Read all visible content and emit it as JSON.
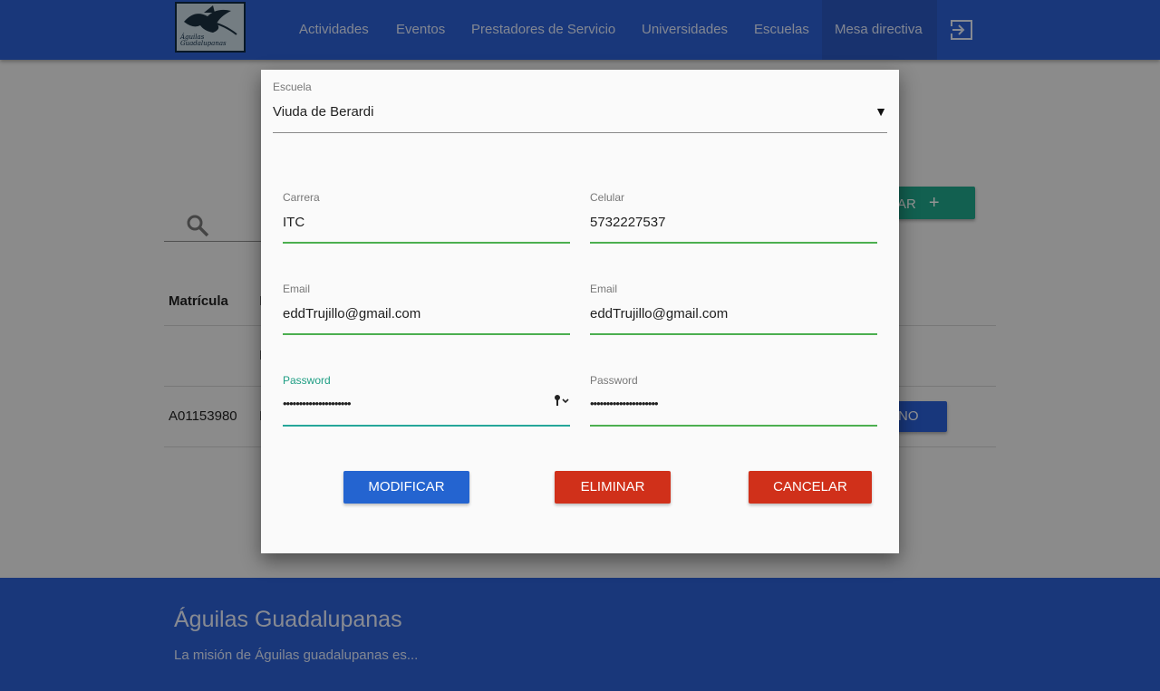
{
  "nav": {
    "logo_text": "Águilas Guadalupanas",
    "items": [
      {
        "label": "Actividades"
      },
      {
        "label": "Eventos"
      },
      {
        "label": "Prestadores de Servicio"
      },
      {
        "label": "Universidades"
      },
      {
        "label": "Escuelas"
      },
      {
        "label": "Mesa directiva"
      }
    ],
    "active_item": "Mesa directiva"
  },
  "page": {
    "add_button_label": "AR",
    "table_header_matricula": "Matrícula",
    "row_matricula": "A01153980",
    "row_button_label": "NO"
  },
  "modal": {
    "escuela": {
      "label": "Escuela",
      "value": "Viuda de Berardi",
      "caret": "▼"
    },
    "carrera": {
      "label": "Carrera",
      "value": "ITC"
    },
    "celular": {
      "label": "Celular",
      "value": "5732227537"
    },
    "email": {
      "label": "Email",
      "value": "eddTrujillo@gmail.com"
    },
    "email_confirm": {
      "label": "Email",
      "value": "eddTrujillo@gmail.com"
    },
    "password": {
      "label": "Password",
      "value": "•••••••••••••••••••••"
    },
    "password_confirm": {
      "label": "Password",
      "value": "•••••••••••••••••••••"
    },
    "buttons": {
      "modify": "MODIFICAR",
      "delete": "ELIMINAR",
      "cancel": "CANCELAR"
    }
  },
  "footer": {
    "title": "Águilas Guadalupanas",
    "text": "La misión de Águilas guadalupanas es..."
  },
  "colors": {
    "nav_bg": "#2c5fd3",
    "teal_accent": "#1fa58a",
    "green_underline": "#4caf50",
    "btn_blue": "#2464d0",
    "btn_red": "#d0301a"
  }
}
